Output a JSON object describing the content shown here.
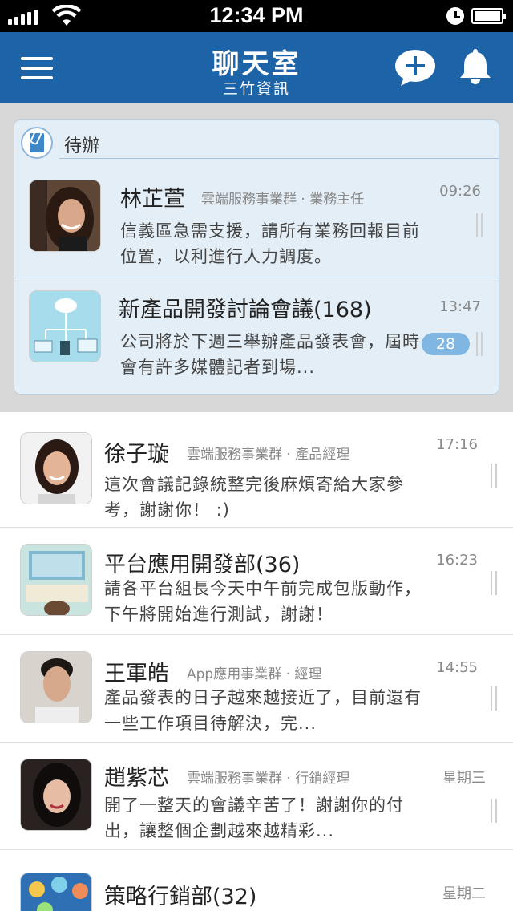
{
  "status_bar": {
    "time": "12:34 PM"
  },
  "nav": {
    "title": "聊天室",
    "subtitle": "三竹資訊"
  },
  "todo": {
    "label": "待辦",
    "items": [
      {
        "name": "林芷萱",
        "meta": "雲端服務事業群 · 業務主任",
        "message": "信義區急需支援，請所有業務回報目前位置，以利進行人力調度。",
        "time": "09:26",
        "avatar": "woman-portrait"
      },
      {
        "name": "新產品開發討論會議(168)",
        "meta": "",
        "message": "公司將於下週三舉辦產品發表會，屆時會有許多媒體記者到場...",
        "time": "13:47",
        "unread": "28",
        "avatar": "group-devices"
      }
    ]
  },
  "chats": [
    {
      "name": "徐子璇",
      "meta": "雲端服務事業群 · 產品經理",
      "message": "這次會議記錄統整完後麻煩寄給大家參考，謝謝你！ :)",
      "time": "17:16",
      "avatar": "woman-portrait"
    },
    {
      "name": "平台應用開發部(36)",
      "meta": "",
      "message": "請各平台組長今天中午前完成包版動作，下午將開始進行測試，謝謝！",
      "time": "16:23",
      "avatar": "desk-illustration"
    },
    {
      "name": "王軍皓",
      "meta": "App應用事業群 · 經理",
      "message": "產品發表的日子越來越接近了，目前還有一些工作項目待解決，完...",
      "time": "14:55",
      "avatar": "man-portrait"
    },
    {
      "name": "趙紫芯",
      "meta": "雲端服務事業群 · 行銷經理",
      "message": "開了一整天的會議辛苦了！謝謝你的付出，讓整個企劃越來越精彩...",
      "time": "星期三",
      "avatar": "woman-portrait"
    },
    {
      "name": "策略行銷部(32)",
      "meta": "",
      "message": "",
      "time": "星期二",
      "avatar": "people-network"
    }
  ],
  "colors": {
    "nav": "#1d63a8",
    "badge": "#7fb7e2",
    "todo_bg": "#e3eef6"
  }
}
